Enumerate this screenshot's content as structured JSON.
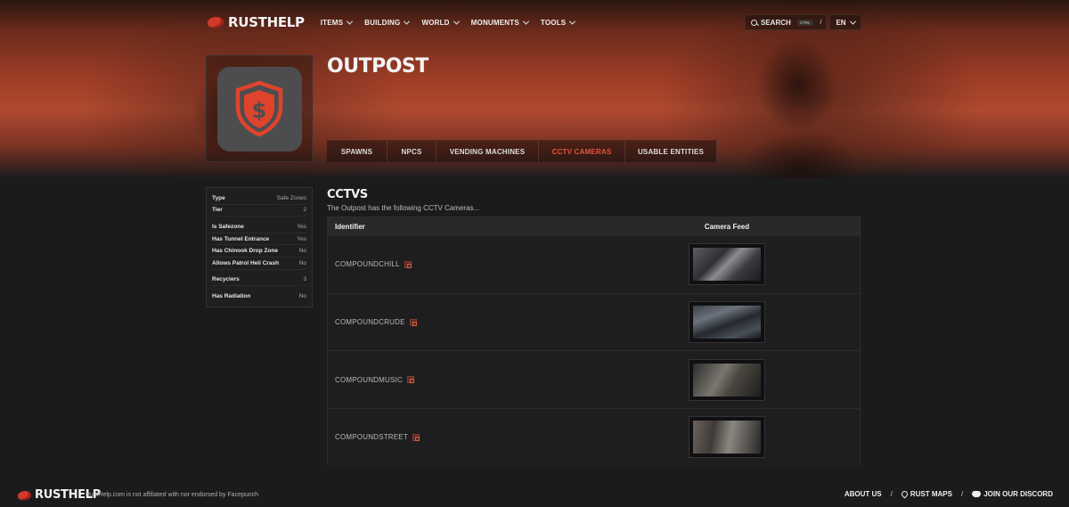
{
  "brand": {
    "name": "RUSTHELP"
  },
  "nav": {
    "items": [
      {
        "label": "ITEMS"
      },
      {
        "label": "BUILDING"
      },
      {
        "label": "WORLD"
      },
      {
        "label": "MONUMENTS"
      },
      {
        "label": "TOOLS"
      }
    ],
    "search_label": "SEARCH",
    "search_kbd": "CTRL",
    "search_slash": "/",
    "lang": "EN"
  },
  "header": {
    "title": "OUTPOST",
    "tabs": [
      {
        "label": "SPAWNS"
      },
      {
        "label": "NPCS"
      },
      {
        "label": "VENDING MACHINES"
      },
      {
        "label": "CCTV CAMERAS"
      },
      {
        "label": "USABLE ENTITIES"
      }
    ],
    "active_tab": "CCTV CAMERAS"
  },
  "info": [
    {
      "label": "Type",
      "value": "Safe Zones"
    },
    {
      "label": "Tier",
      "value": "2"
    },
    {
      "label": "Is Safezone",
      "value": "Yes"
    },
    {
      "label": "Has Tunnel Entrance",
      "value": "Yes"
    },
    {
      "label": "Has Chinook Drop Zone",
      "value": "No"
    },
    {
      "label": "Allows Patrol Heli Crash",
      "value": "No"
    },
    {
      "label": "Recyclers",
      "value": "3"
    },
    {
      "label": "Has Radiation",
      "value": "No"
    }
  ],
  "main": {
    "section_title": "CCTVS",
    "section_desc": "The Outpost has the following CCTV Cameras...",
    "col_identifier": "Identifier",
    "col_feed": "Camera Feed",
    "rows": [
      {
        "id": "COMPOUNDCHILL"
      },
      {
        "id": "COMPOUNDCRUDE"
      },
      {
        "id": "COMPOUNDMUSIC"
      },
      {
        "id": "COMPOUNDSTREET"
      }
    ]
  },
  "footer": {
    "disclaimer": "RustHelp.com is not affiliated with nor endorsed by Facepunch",
    "about": "ABOUT US",
    "maps": "RUST MAPS",
    "discord": "JOIN OUR DISCORD",
    "separator": "/"
  },
  "colors": {
    "accent": "#e2553c",
    "shield": "#e0432c",
    "background": "#1b1b1d"
  }
}
